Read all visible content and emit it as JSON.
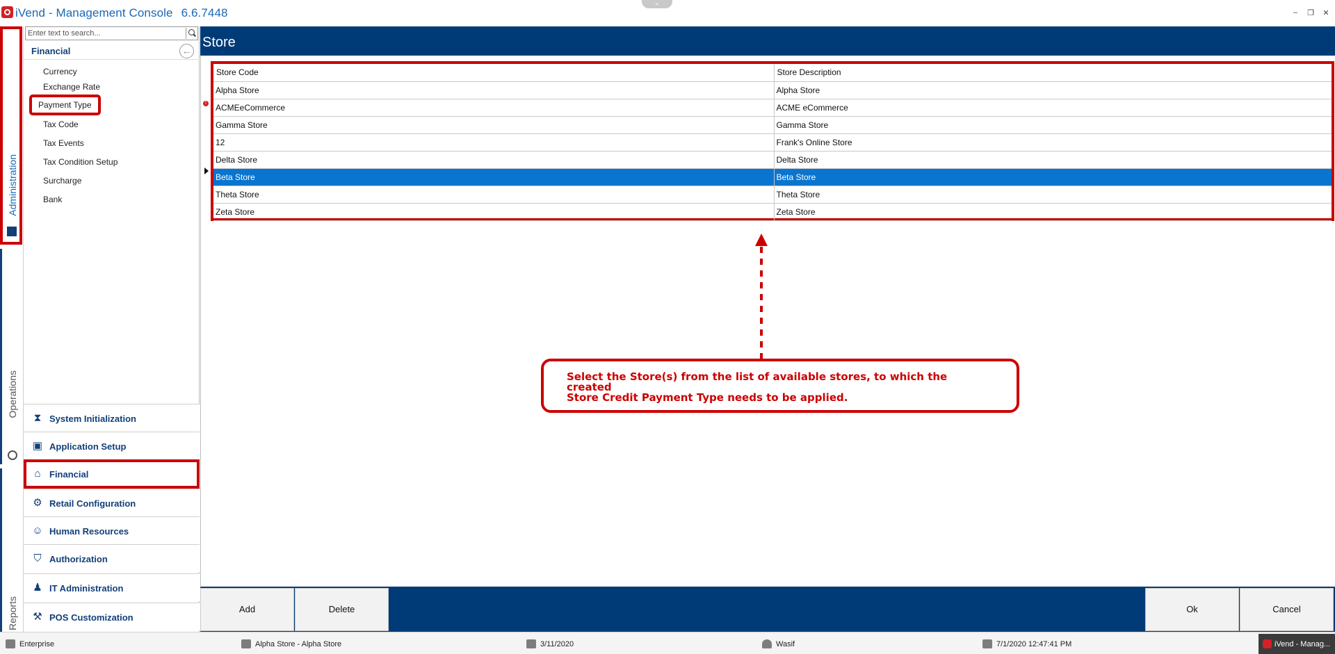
{
  "window": {
    "title": "iVend - Management Console",
    "version": "6.6.7448",
    "controls": [
      "–",
      "❐",
      "✕"
    ]
  },
  "vnav": {
    "items": [
      {
        "label": "Administration",
        "icon": "building-icon"
      },
      {
        "label": "Operations",
        "icon": "gear-icon"
      },
      {
        "label": "Reports",
        "icon": "report-icon"
      }
    ]
  },
  "sidepanel": {
    "search_placeholder": "Enter text to search...",
    "section_title": "Financial",
    "menu": [
      {
        "label": "Currency"
      },
      {
        "label": "Exchange Rate"
      },
      {
        "label": "Payment Type"
      },
      {
        "label": "Tax Code"
      },
      {
        "label": "Tax Events"
      },
      {
        "label": "Tax Condition Setup"
      },
      {
        "label": "Surcharge"
      },
      {
        "label": "Bank"
      }
    ],
    "modules": [
      {
        "label": "System Initialization",
        "icon": "hourglass-icon"
      },
      {
        "label": "Application Setup",
        "icon": "window-icon"
      },
      {
        "label": "Financial",
        "icon": "bank-icon"
      },
      {
        "label": "Retail Configuration",
        "icon": "gears-icon"
      },
      {
        "label": "Human Resources",
        "icon": "people-icon"
      },
      {
        "label": "Authorization",
        "icon": "shield-icon"
      },
      {
        "label": "IT Administration",
        "icon": "admin-user-icon"
      },
      {
        "label": "POS Customization",
        "icon": "pos-icon"
      }
    ]
  },
  "main": {
    "title": "Store",
    "columns": [
      "Store Code",
      "Store Description"
    ],
    "rows": [
      [
        "Alpha Store",
        "Alpha Store"
      ],
      [
        "ACMEeCommerce",
        "ACME eCommerce"
      ],
      [
        "Gamma Store",
        "Gamma Store"
      ],
      [
        "12",
        "Frank's Online Store"
      ],
      [
        "Delta Store",
        "Delta Store"
      ],
      [
        "Beta Store",
        "Beta Store"
      ],
      [
        "Theta Store",
        "Theta Store"
      ],
      [
        "Zeta Store",
        "Zeta Store"
      ]
    ],
    "callout": {
      "line1": "Select the Store(s) from the list of available stores, to which the created",
      "line2": "Store Credit Payment Type needs to be applied."
    }
  },
  "actions": {
    "add": "Add",
    "delete": "Delete",
    "ok": "Ok",
    "cancel": "Cancel"
  },
  "status": {
    "edition": "Enterprise",
    "store": "Alpha Store - Alpha Store",
    "business_date": "3/11/2020",
    "user": "Wasif",
    "login_time": "7/1/2020 12:47:41 PM",
    "taskbar": "iVend - Manag..."
  },
  "colors": {
    "primary": "#003b77",
    "selection": "#0a75cf",
    "highlight": "#cc0000"
  }
}
